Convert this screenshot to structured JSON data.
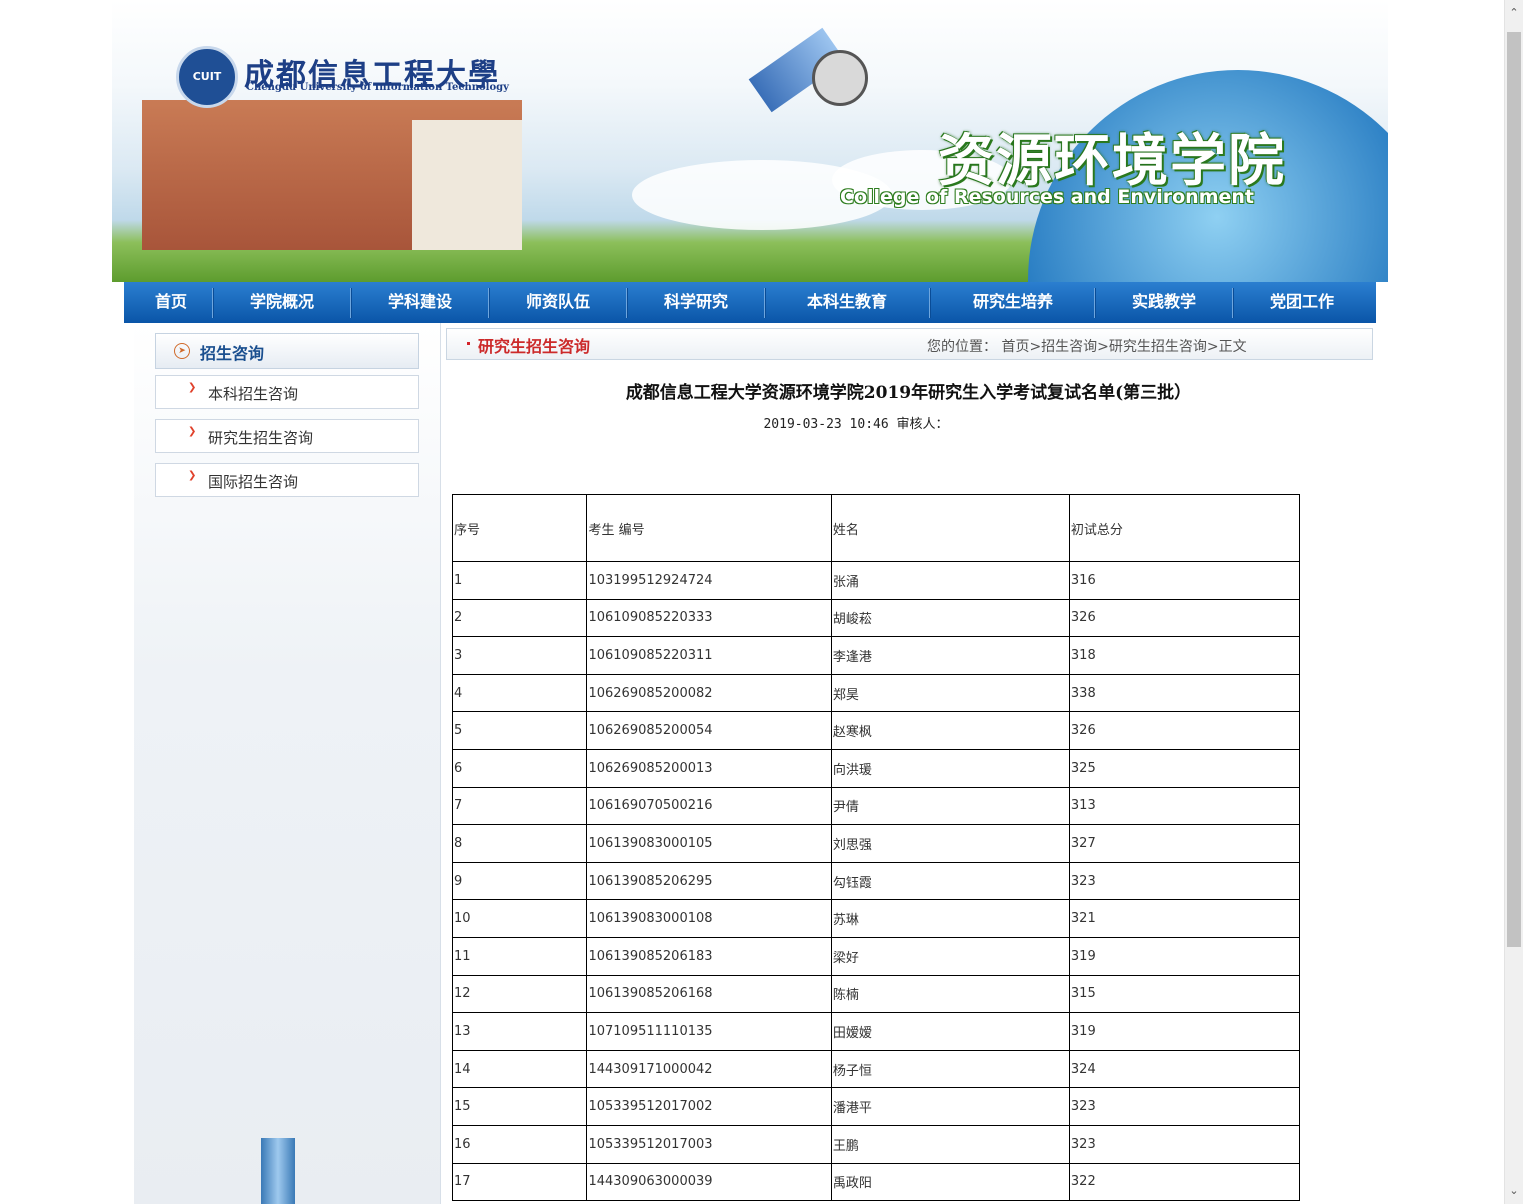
{
  "banner": {
    "logo_seal": "CUIT",
    "logo_cn": "成都信息工程大學",
    "logo_en": "Chengdu University of Information Technology",
    "college_cn": "资源环境学院",
    "college_en": "College of Resources and Environment"
  },
  "nav": {
    "items": [
      "首页",
      "学院概况",
      "学科建设",
      "师资队伍",
      "科学研究",
      "本科生教育",
      "研究生培养",
      "实践教学",
      "党团工作"
    ]
  },
  "sidebar": {
    "heading": "招生咨询",
    "items": [
      "本科招生咨询",
      "研究生招生咨询",
      "国际招生咨询"
    ]
  },
  "breadcrumb": {
    "category": "研究生招生咨询",
    "location_text": "您的位置：  首页>招生咨询>研究生招生咨询>正文"
  },
  "article": {
    "title": "成都信息工程大学资源环境学院2019年研究生入学考试复试名单(第三批）",
    "meta": "2019-03-23 10:46   审核人："
  },
  "table": {
    "headers": [
      "序号",
      "考生 编号",
      "姓名",
      "初试总分"
    ],
    "rows": [
      [
        "1",
        "103199512924724",
        "张涌",
        "316"
      ],
      [
        "2",
        "106109085220333",
        "胡峻菘",
        "326"
      ],
      [
        "3",
        "106109085220311",
        "李逢港",
        "318"
      ],
      [
        "4",
        "106269085200082",
        "郑昊",
        "338"
      ],
      [
        "5",
        "106269085200054",
        "赵寒枫",
        "326"
      ],
      [
        "6",
        "106269085200013",
        "向洪瑗",
        "325"
      ],
      [
        "7",
        "106169070500216",
        "尹倩",
        "313"
      ],
      [
        "8",
        "106139083000105",
        "刘思强",
        "327"
      ],
      [
        "9",
        "106139085206295",
        "勾钰霞",
        "323"
      ],
      [
        "10",
        "106139083000108",
        "苏琳",
        "321"
      ],
      [
        "11",
        "106139085206183",
        "梁好",
        "319"
      ],
      [
        "12",
        "106139085206168",
        "陈楠",
        "315"
      ],
      [
        "13",
        "107109511110135",
        "田嫒嫒",
        "319"
      ],
      [
        "14",
        "144309171000042",
        "杨子恒",
        "324"
      ],
      [
        "15",
        "105339512017002",
        "潘港平",
        "323"
      ],
      [
        "16",
        "105339512017003",
        "王鹏",
        "323"
      ],
      [
        "17",
        "144309063000039",
        "禹政阳",
        "322"
      ]
    ]
  },
  "icons": {
    "scroll_up": "scroll-up-icon",
    "scroll_down": "scroll-down-icon",
    "sidebar_head": "circle-arrow-icon",
    "sidebar_item": "red-arrow-icon"
  },
  "colors": {
    "nav_blue": "#0a55a8",
    "accent_red": "#cc2a2a",
    "heading_blue": "#1a4f8f"
  }
}
